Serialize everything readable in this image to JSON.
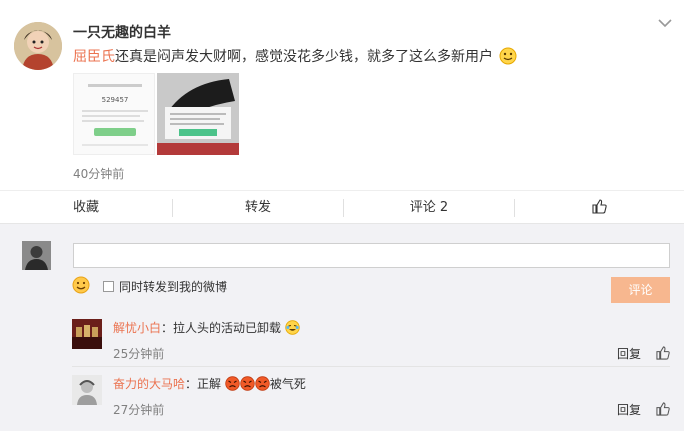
{
  "post": {
    "username": "一只无趣的白羊",
    "mention": "屈臣氏",
    "text": "还真是闷声发大财啊，感觉没花多少钱，就多了这么多新用户",
    "time": "40分钟前",
    "thumb1_number": "529457"
  },
  "actions": {
    "collect": "收藏",
    "repost": "转发",
    "comment": "评论 2"
  },
  "compose": {
    "input_value": "",
    "repost_checkbox_label": "同时转发到我的微博",
    "submit_label": "评论"
  },
  "comments": [
    {
      "name": "解忧小白",
      "text": "：拉人头的活动已卸载",
      "time": "25分钟前",
      "reply": "回复"
    },
    {
      "name": "奋力的大马哈",
      "text_prefix": "：正解",
      "text_suffix": "被气死",
      "time": "27分钟前",
      "reply": "回复"
    }
  ],
  "colors": {
    "accent": "#eb7350",
    "submit_disabled": "#f7b78f"
  },
  "icons": [
    "chevron-down-icon",
    "smile-emoji-icon",
    "like-icon",
    "emoji-picker-icon",
    "cry-laugh-emoji-icon",
    "angry-emoji-icon"
  ]
}
